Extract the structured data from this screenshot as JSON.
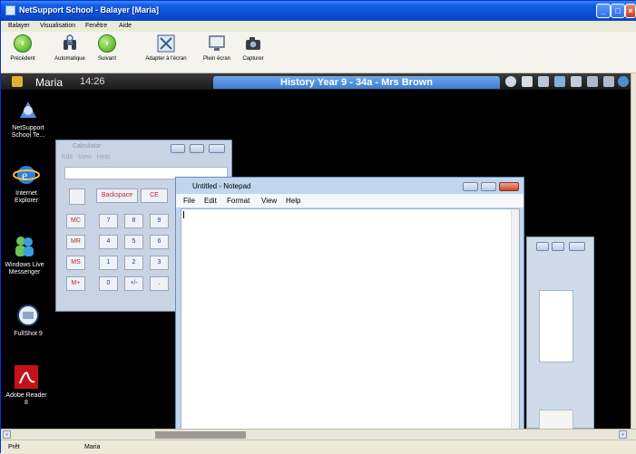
{
  "window": {
    "title": "NetSupport School - Balayer [Maria]"
  },
  "menu": [
    "Balayer",
    "Visualisation",
    "Fenêtre",
    "Aide"
  ],
  "toolbar": [
    {
      "label": "Précédent",
      "icon": "back-arrow-icon"
    },
    {
      "label": "Automatique",
      "icon": "auto-binoculars-icon"
    },
    {
      "label": "Suivant",
      "icon": "forward-arrow-icon"
    },
    {
      "label": "Adapter à l'écran",
      "icon": "fit-screen-icon"
    },
    {
      "label": "Plein écran",
      "icon": "fullscreen-icon"
    },
    {
      "label": "Capturer",
      "icon": "camera-icon"
    }
  ],
  "student_bar": {
    "name": "Maria",
    "time": "14:26",
    "lesson": "History Year 9 - 34a - Mrs Brown"
  },
  "desktop_icons": [
    {
      "label": "NetSupport School Te...",
      "icon": "netsupport-icon"
    },
    {
      "label": "Internet Explorer",
      "icon": "ie-icon"
    },
    {
      "label": "Windows Live Messenger",
      "icon": "messenger-icon"
    },
    {
      "label": "FullShot 9",
      "icon": "fullshot-icon"
    },
    {
      "label": "Adobe Reader 8",
      "icon": "adobe-reader-icon"
    }
  ],
  "calculator": {
    "title": "Calculator",
    "menu": [
      "Edit",
      "View",
      "Help"
    ],
    "keys": {
      "backspace": "Backspace",
      "ce": "CE",
      "mem": [
        "MC",
        "MR",
        "MS",
        "M+"
      ],
      "row1": [
        "7",
        "8",
        "9"
      ],
      "row2": [
        "4",
        "5",
        "6"
      ],
      "row3": [
        "1",
        "2",
        "3"
      ],
      "row4": [
        "0",
        "+/-",
        "."
      ]
    }
  },
  "notepad": {
    "title": "Untitled - Notepad",
    "menu": [
      "File",
      "Edit",
      "Format",
      "View",
      "Help"
    ],
    "content": ""
  },
  "status": {
    "left": "Prêt",
    "name": "Maria"
  },
  "colors": {
    "titlebar": "#0a52d6",
    "lesson_bar": "#3d7cd3",
    "desktop": "#000000"
  }
}
